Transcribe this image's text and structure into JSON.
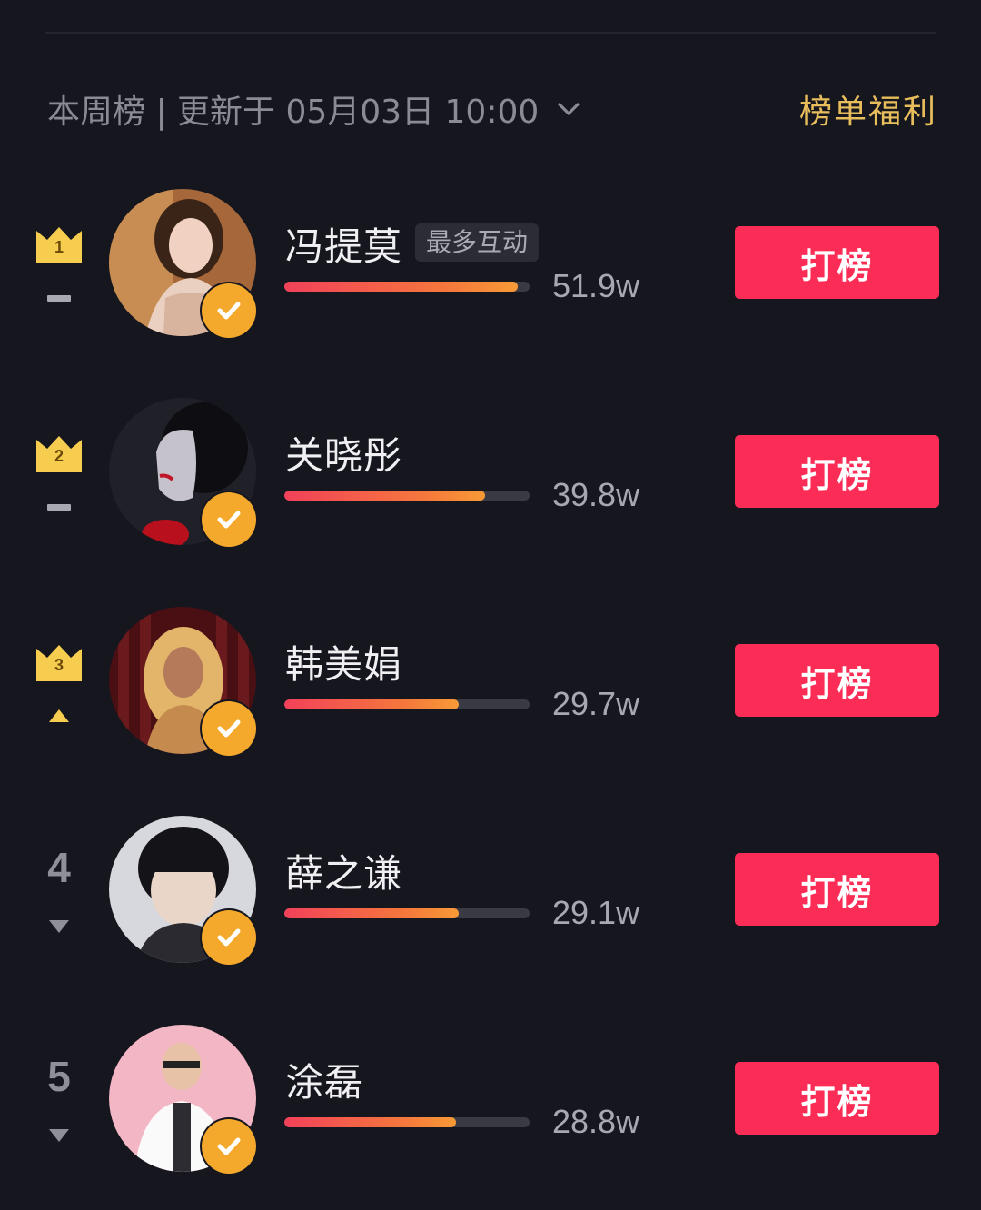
{
  "header": {
    "left_text": "本周榜 | 更新于 05月03日 10:00",
    "right_link": "榜单福利"
  },
  "entries": [
    {
      "rank": "1",
      "name": "冯提莫",
      "tag": "最多互动",
      "score": "51.9w",
      "progress": 0.95,
      "trend": "same",
      "button": "打榜"
    },
    {
      "rank": "2",
      "name": "关晓彤",
      "tag": "",
      "score": "39.8w",
      "progress": 0.82,
      "trend": "same",
      "button": "打榜"
    },
    {
      "rank": "3",
      "name": "韩美娟",
      "tag": "",
      "score": "29.7w",
      "progress": 0.71,
      "trend": "up",
      "button": "打榜"
    },
    {
      "rank": "4",
      "name": "薛之谦",
      "tag": "",
      "score": "29.1w",
      "progress": 0.71,
      "trend": "down",
      "button": "打榜"
    },
    {
      "rank": "5",
      "name": "涂磊",
      "tag": "",
      "score": "28.8w",
      "progress": 0.7,
      "trend": "down",
      "button": "打榜"
    }
  ],
  "colors": {
    "background": "#16161f",
    "accent_red": "#fb2c55",
    "gold": "#e8bd5c",
    "crown": "#f6cd4f",
    "verified": "#f5a92c"
  },
  "icons": {
    "dropdown": "chevron-down-icon",
    "crown": "crown-icon",
    "verified": "verified-check-icon",
    "trend_same": "dash-icon",
    "trend_up": "triangle-up-icon",
    "trend_down": "triangle-down-icon"
  }
}
